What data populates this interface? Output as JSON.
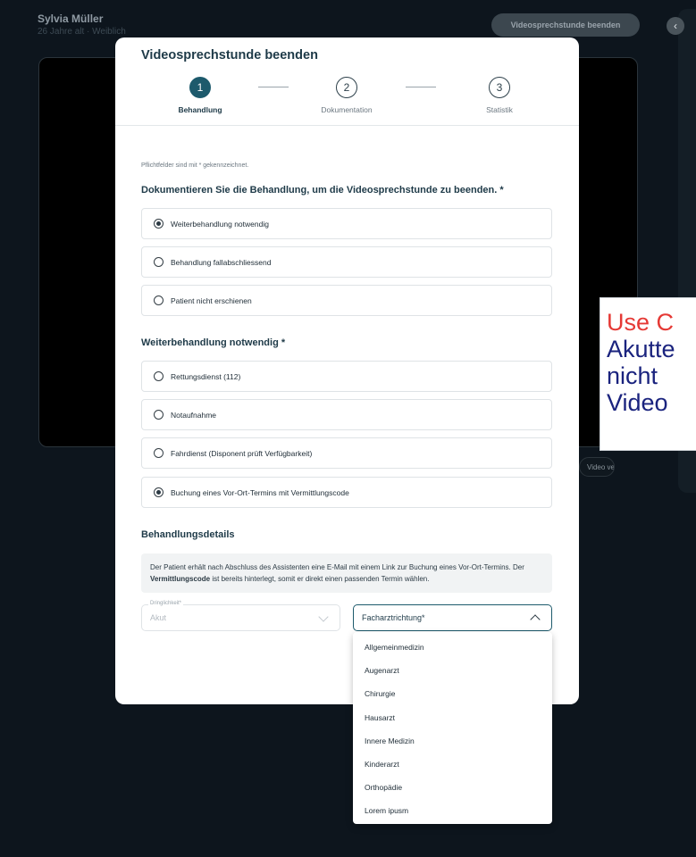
{
  "background": {
    "patient_name": "Sylvia Müller",
    "patient_sub": "26 Jahre alt · Weiblich",
    "end_button": "Videosprechstunde beenden",
    "pill_text": "Video ver"
  },
  "annotation": {
    "line1": "Use C",
    "line2": "Akutte",
    "line3": "nicht",
    "line4": "Video"
  },
  "modal": {
    "title": "Videosprechstunde beenden",
    "steps": [
      {
        "num": "1",
        "label": "Behandlung"
      },
      {
        "num": "2",
        "label": "Dokumentation"
      },
      {
        "num": "3",
        "label": "Statistik"
      }
    ],
    "hint": "Pflichtfelder sind mit * gekennzeichnet.",
    "section1_title": "Dokumentieren Sie die Behandlung, um die Videosprechstunde zu beenden. *",
    "options1": [
      {
        "label": "Weiterbehandlung notwendig",
        "checked": true
      },
      {
        "label": "Behandlung fallabschliessend",
        "checked": false
      },
      {
        "label": "Patient nicht erschienen",
        "checked": false
      }
    ],
    "section2_title": "Weiterbehandlung notwendig *",
    "options2": [
      {
        "label": "Rettungsdienst (112)",
        "checked": false
      },
      {
        "label": "Notaufnahme",
        "checked": false
      },
      {
        "label": "Fahrdienst (Disponent prüft Verfügbarkeit)",
        "checked": false
      },
      {
        "label": "Buchung eines Vor-Ort-Termins mit Vermittlungscode",
        "checked": true
      }
    ],
    "section3_title": "Behandlungsdetails",
    "info_part1": "Der Patient erhält nach Abschluss des Assistenten eine E-Mail mit einem Link zur Buchung eines Vor-Ort-Termins. Der ",
    "info_bold": "Vermittlungscode",
    "info_part2": " ist bereits hinterlegt, somit er direkt einen passenden Termin wählen.",
    "urgency_legend": "Dringlichkeit*",
    "urgency_value": "Akut",
    "specialty_label": "Facharztrichtung*"
  },
  "dropdown": {
    "items": [
      "Allgemeinmedizin",
      "Augenarzt",
      "Chirurgie",
      "Hausarzt",
      "Innere Medizin",
      "Kinderarzt",
      "Orthopädie",
      "Lorem ipusm"
    ]
  },
  "colors": {
    "accent": "#1d5a6c",
    "background": "#0d151d"
  }
}
